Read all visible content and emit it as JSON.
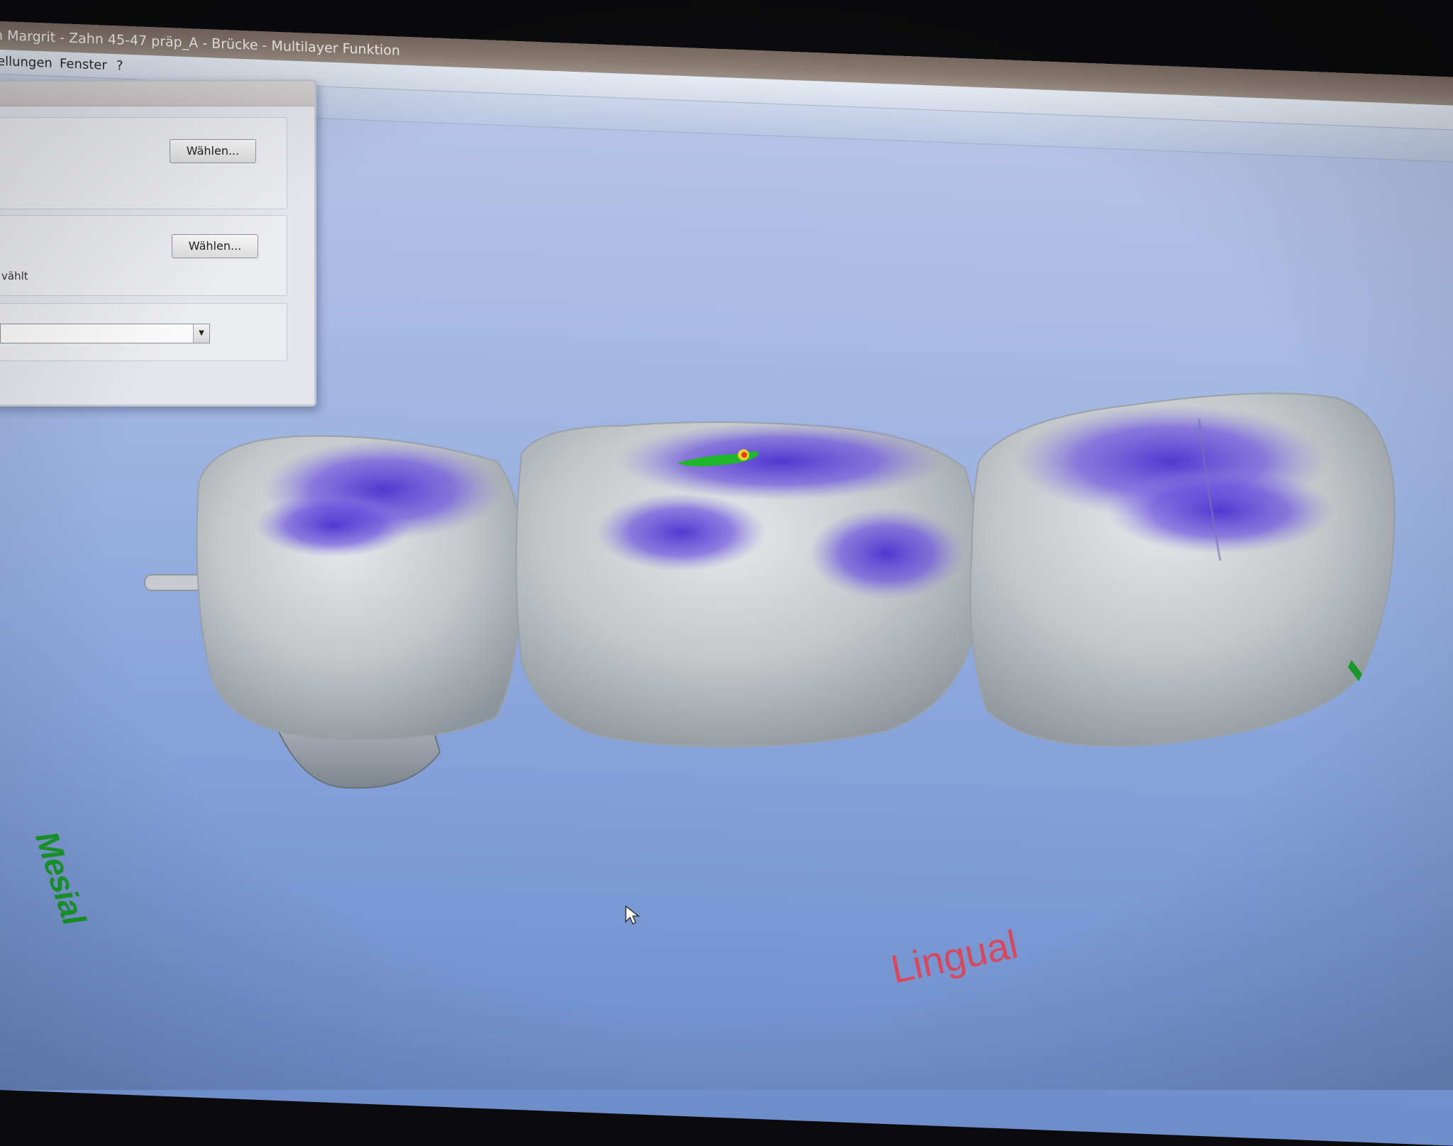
{
  "window": {
    "title": "n Margrit - Zahn 45-47 präp_A - Brücke - Multilayer Funktion"
  },
  "menu": {
    "items": [
      {
        "label": "ellungen"
      },
      {
        "label": "Fenster"
      },
      {
        "label": "?"
      }
    ]
  },
  "dialog": {
    "button1_label": "Wählen...",
    "button2_label": "Wählen...",
    "status_text": "vählt",
    "combo_value": ""
  },
  "viewport": {
    "label_mesial": "Mesial",
    "label_lingual": "Lingual",
    "colors": {
      "tooth": "#c9ccce",
      "contact_violet": "#5a3fd6",
      "contact_green": "#21b52b",
      "contact_red": "#e43a1f",
      "background": "#8fa9dd"
    }
  }
}
